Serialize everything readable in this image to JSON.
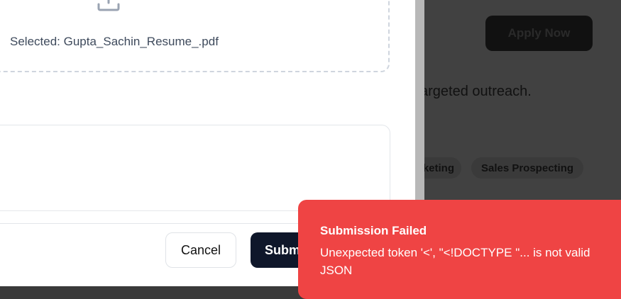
{
  "background_page": {
    "apply_button_label": "Apply Now",
    "description_fragment": "argeted outreach.",
    "tags": [
      "keting",
      "Sales Prospecting"
    ]
  },
  "modal": {
    "upload": {
      "icon": "upload-icon",
      "selected_text": "Selected: Gupta_Sachin_Resume_.pdf"
    },
    "textarea_value": "",
    "cancel_label": "Cancel",
    "submit_label": "Subm"
  },
  "toast": {
    "title": "Submission Failed",
    "message": "Unexpected token '<', \"<!DOCTYPE \"... is not valid JSON"
  },
  "colors": {
    "toast_bg": "#ef4444",
    "submit_bg": "#0f172a",
    "overlay": "#414141"
  }
}
